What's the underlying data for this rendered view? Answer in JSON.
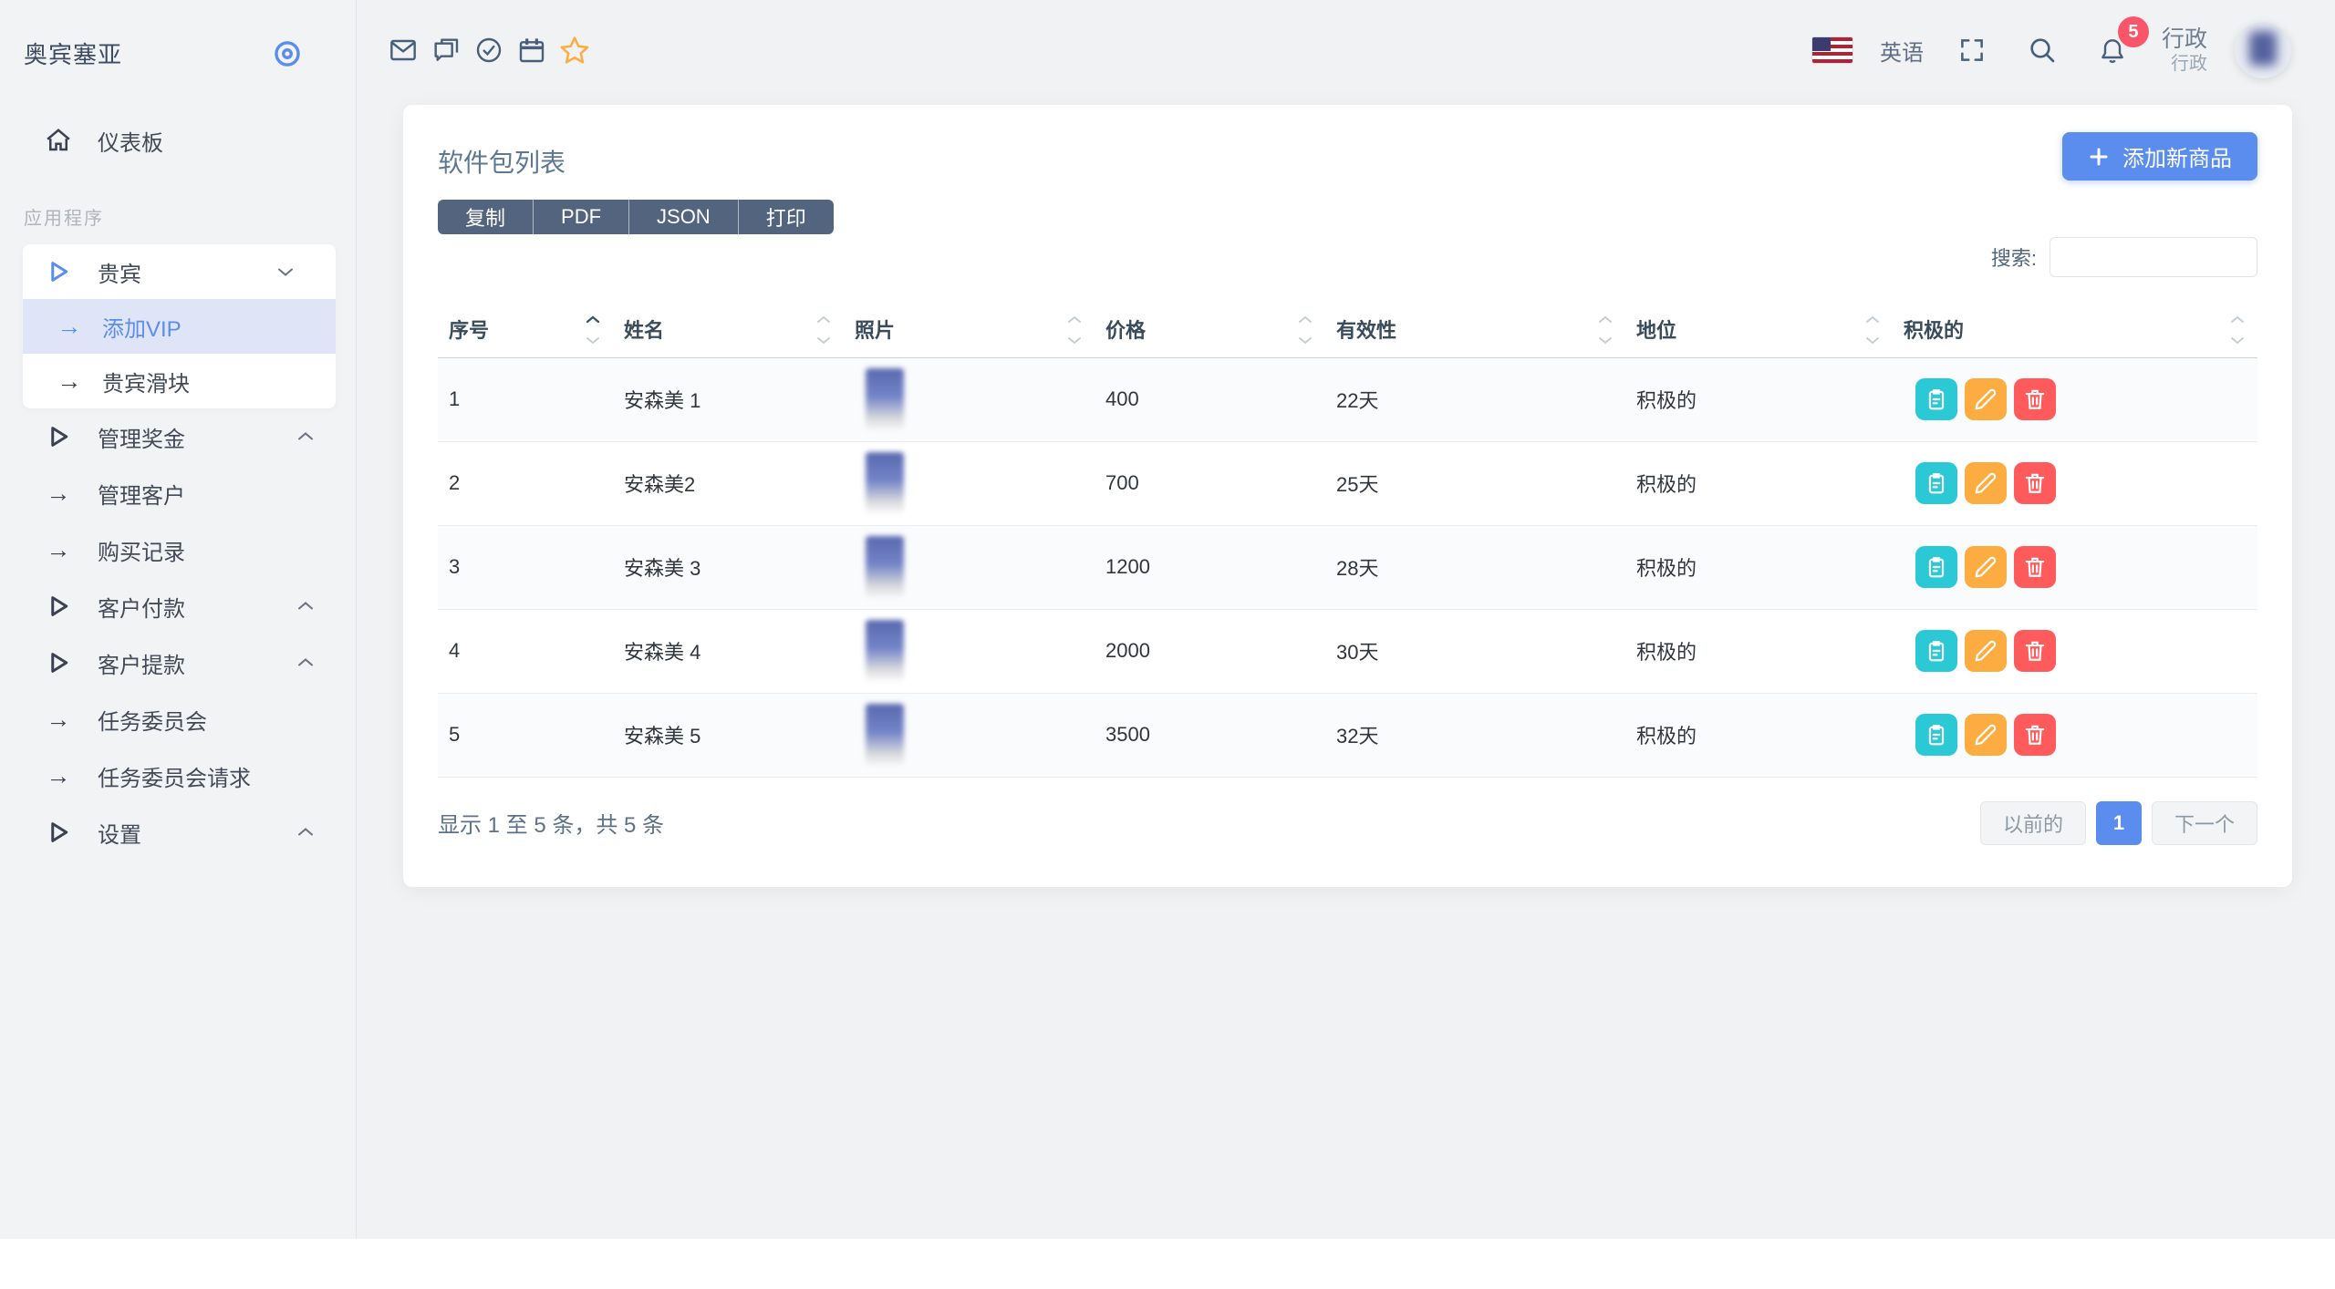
{
  "colors": {
    "primary": "#5a8dee",
    "danger": "#ff5b5c",
    "warning": "#fdac41",
    "info": "#2bc9d6",
    "export_btn": "#53647e"
  },
  "brand": {
    "title": "奥宾塞亚"
  },
  "header": {
    "language": "英语",
    "notification_count": "5",
    "user_name": "行政",
    "user_role": "行政"
  },
  "sidebar": {
    "section_label": "应用程序",
    "items": [
      {
        "label": "仪表板"
      },
      {
        "label": "贵宾"
      },
      {
        "label": "添加VIP",
        "active": true
      },
      {
        "label": "贵宾滑块"
      },
      {
        "label": "管理奖金"
      },
      {
        "label": "管理客户"
      },
      {
        "label": "购买记录"
      },
      {
        "label": "客户付款"
      },
      {
        "label": "客户提款"
      },
      {
        "label": "任务委员会"
      },
      {
        "label": "任务委员会请求"
      },
      {
        "label": "设置"
      }
    ]
  },
  "card": {
    "title": "软件包列表",
    "export_buttons": [
      "复制",
      "PDF",
      "JSON",
      "打印"
    ],
    "add_button": "添加新商品",
    "search_label": "搜索:",
    "table": {
      "headers": [
        "序号",
        "姓名",
        "照片",
        "价格",
        "有效性",
        "地位",
        "积极的"
      ],
      "rows": [
        {
          "sn": "1",
          "name": "安森美 1",
          "price": "400",
          "validity": "22天",
          "status": "积极的"
        },
        {
          "sn": "2",
          "name": "安森美2",
          "price": "700",
          "validity": "25天",
          "status": "积极的"
        },
        {
          "sn": "3",
          "name": "安森美 3",
          "price": "1200",
          "validity": "28天",
          "status": "积极的"
        },
        {
          "sn": "4",
          "name": "安森美 4",
          "price": "2000",
          "validity": "30天",
          "status": "积极的"
        },
        {
          "sn": "5",
          "name": "安森美 5",
          "price": "3500",
          "validity": "32天",
          "status": "积极的"
        }
      ]
    },
    "footer": {
      "info": "显示 1 至 5 条，共 5 条",
      "prev": "以前的",
      "page": "1",
      "next": "下一个"
    }
  }
}
